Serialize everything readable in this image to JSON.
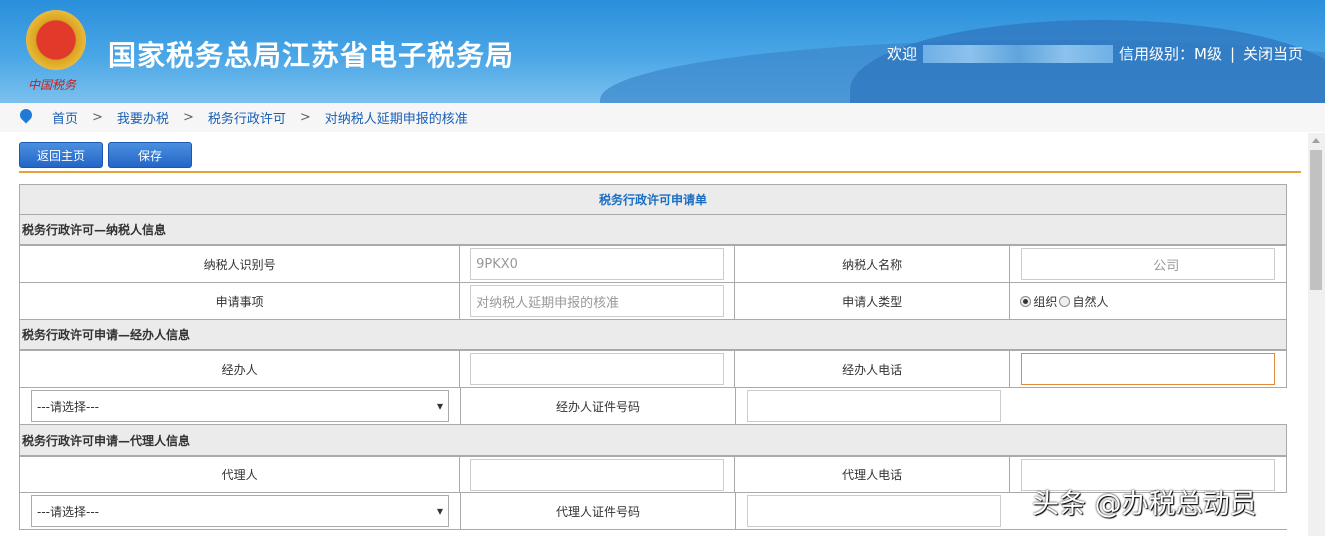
{
  "header": {
    "title": "国家税务总局江苏省电子税务局",
    "emblem_text": "中国税务",
    "welcome": "欢迎",
    "credit": "信用级别：M级",
    "divider": "|",
    "close": "关闭当页"
  },
  "breadcrumb": [
    "首页",
    "我要办税",
    "税务行政许可",
    "对纳税人延期申报的核准"
  ],
  "breadcrumb_sep": ">",
  "toolbar": {
    "back": "返回主页",
    "save": "保存"
  },
  "form": {
    "title": "税务行政许可申请单",
    "sec1": "税务行政许可—纳税人信息",
    "taxpayer_id_label": "纳税人识别号",
    "taxpayer_id_value": "9PKX0",
    "taxpayer_name_label": "纳税人名称",
    "taxpayer_name_value": "公司",
    "item_label": "申请事项",
    "item_value": "对纳税人延期申报的核准",
    "applicant_type_label": "申请人类型",
    "applicant_type_options": [
      "组织",
      "自然人"
    ],
    "sec2": "税务行政许可申请—经办人信息",
    "handler_label": "经办人",
    "handler_phone_label": "经办人电话",
    "handler_id_type_placeholder": "---请选择---",
    "handler_id_label": "经办人证件号码",
    "sec3": "税务行政许可申请—代理人信息",
    "agent_label": "代理人",
    "agent_phone_label": "代理人电话",
    "agent_id_type_placeholder": "---请选择---",
    "agent_id_label": "代理人证件号码"
  },
  "watermark": "头条 @办税总动员"
}
